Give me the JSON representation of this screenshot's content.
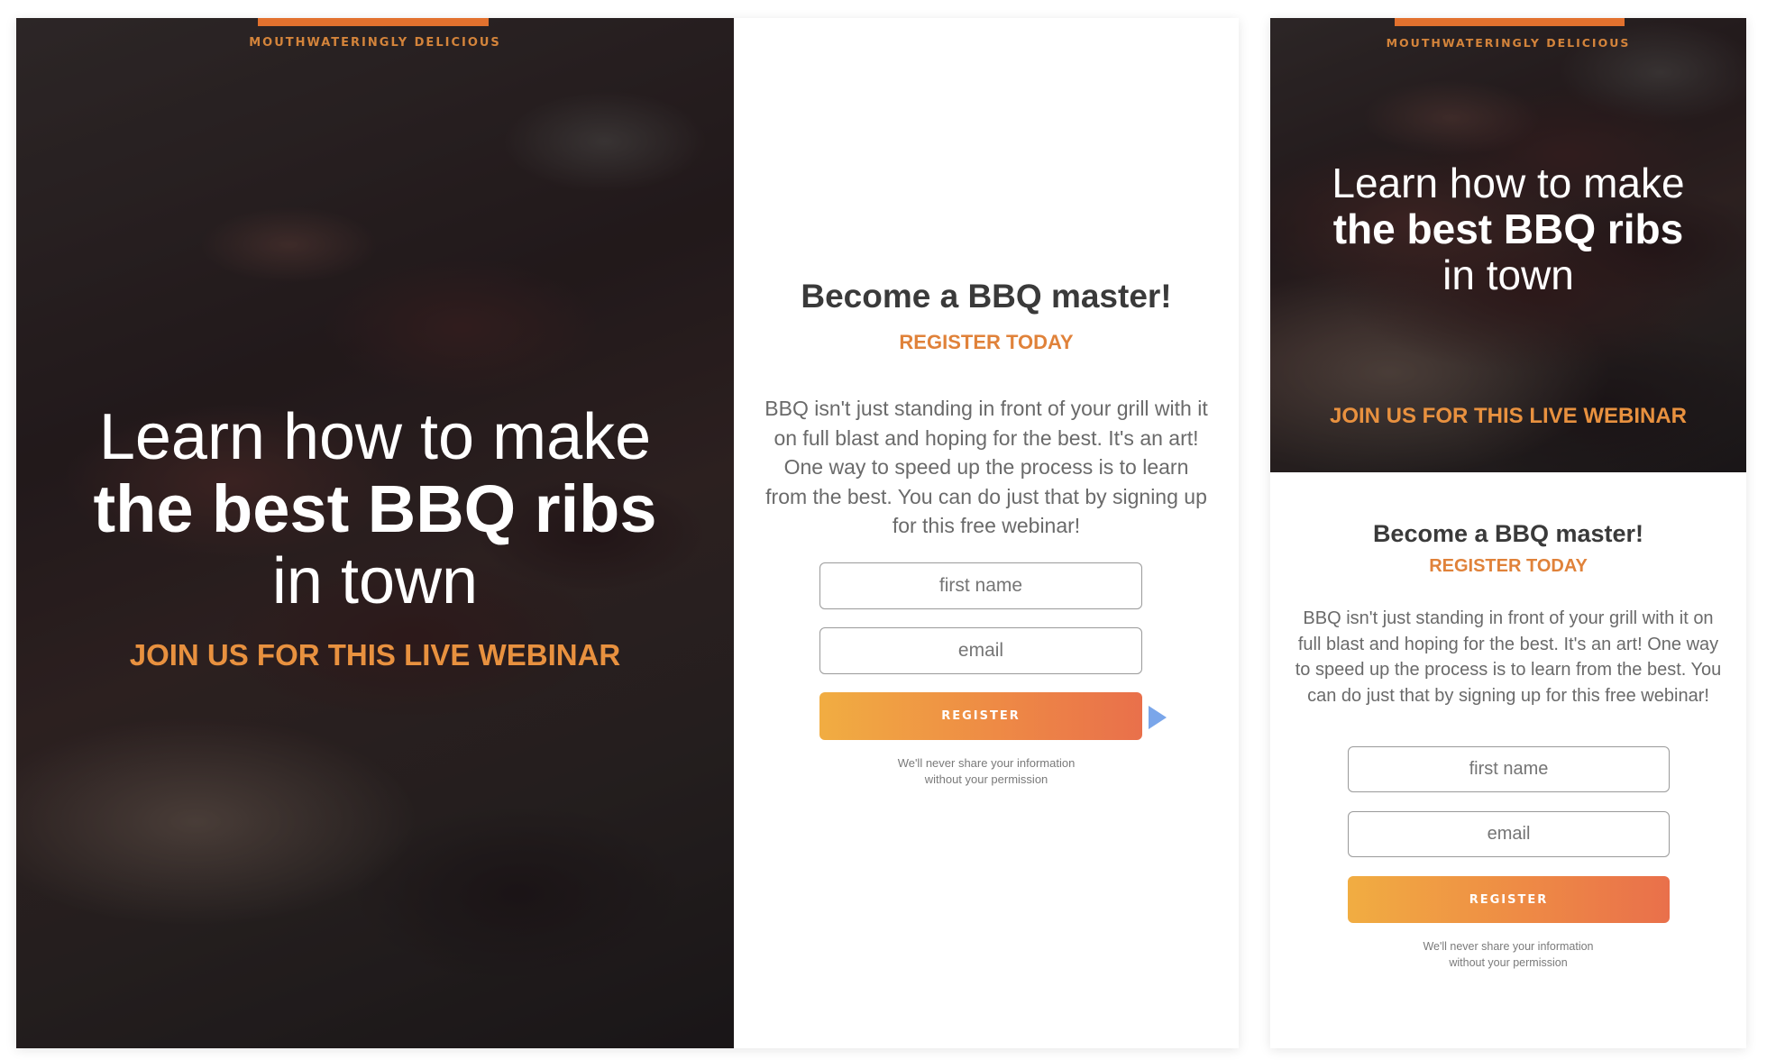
{
  "desktop": {
    "eyebrow": "MOUTHWATERINGLY DELICIOUS",
    "hero": {
      "line1": "Learn how to make",
      "line2": "the best BBQ ribs",
      "line3": "in town",
      "subtitle": "JOIN US FOR THIS LIVE WEBINAR"
    },
    "form": {
      "heading": "Become a BBQ master!",
      "subheading": "REGISTER TODAY",
      "body": "BBQ isn't just standing in front of your grill with it on full blast and hoping for the best. It's an art! One way to speed up the process is to learn from the best. You can do just that by signing up for this free webinar!",
      "first_name_placeholder": "first name",
      "email_placeholder": "email",
      "button_label": "REGISTER",
      "privacy_line1": "We'll never share your information",
      "privacy_line2": "without your permission"
    }
  },
  "mobile": {
    "eyebrow": "MOUTHWATERINGLY DELICIOUS",
    "hero": {
      "line1": "Learn how to make",
      "line2": "the best BBQ ribs",
      "line3": "in town",
      "subtitle": "JOIN US FOR THIS LIVE WEBINAR"
    },
    "form": {
      "heading": "Become a BBQ master!",
      "subheading": "REGISTER TODAY",
      "body": "BBQ isn't just standing in front of your grill with it on full blast and hoping for the best. It's an art! One way to speed up the process is to learn from the best. You can do just that by signing up for this free webinar!",
      "first_name_placeholder": "first name",
      "email_placeholder": "email",
      "button_label": "REGISTER",
      "privacy_line1": "We'll never share your information",
      "privacy_line2": "without your permission"
    }
  },
  "colors": {
    "accent_orange": "#e2712e",
    "subtitle_orange": "#e8913f",
    "button_gradient_start": "#f1ad42",
    "button_gradient_end": "#e9704b",
    "cursor_blue": "#7aa6ea"
  },
  "icons": {
    "cursor": "pointer-arrow-icon"
  }
}
